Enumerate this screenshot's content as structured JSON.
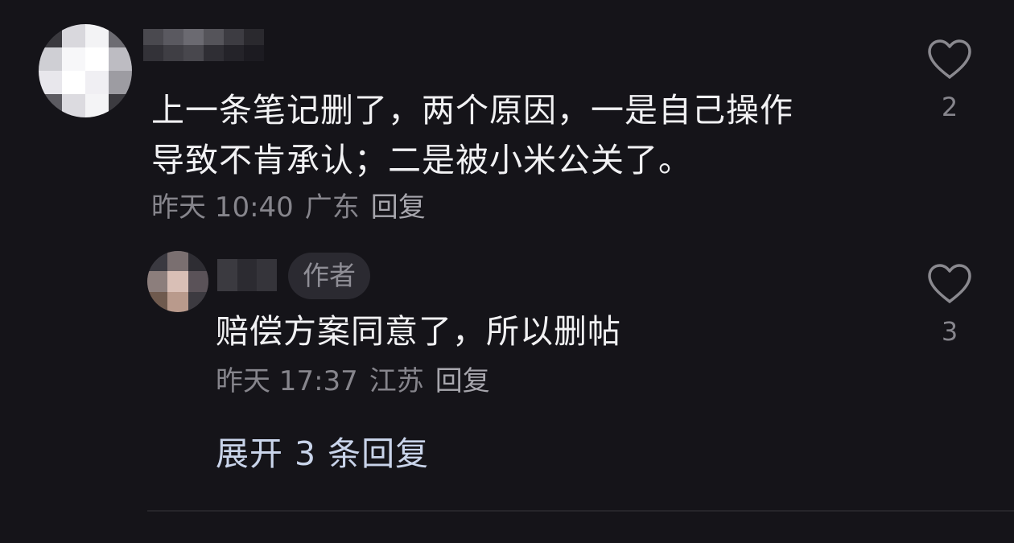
{
  "main_comment": {
    "text_line1": "上一条笔记删了，两个原因，一是自己操作",
    "text_line2": "导致不肯承认；二是被小米公关了。",
    "time": "昨天 10:40",
    "location": "广东",
    "reply_label": "回复",
    "like_count": "2"
  },
  "reply_comment": {
    "badge": "作者",
    "text": "赔偿方案同意了，所以删帖",
    "time": "昨天 17:37",
    "location": "江苏",
    "reply_label": "回复",
    "like_count": "3"
  },
  "expand_replies": "展开 3 条回复",
  "colors": {
    "background": "#151419",
    "text_primary": "#f1f1f3",
    "text_meta": "#86858c",
    "link": "#c9d4ea",
    "badge_bg": "#2b2a31"
  },
  "icons": {
    "like": "heart-outline-icon"
  }
}
